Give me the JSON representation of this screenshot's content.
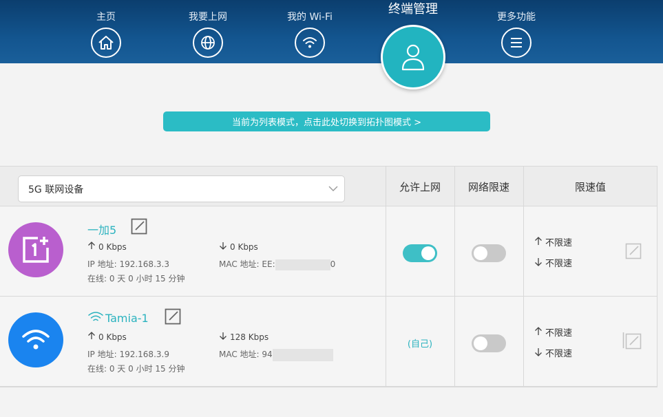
{
  "nav": {
    "items": [
      {
        "label": "主页",
        "icon": "home-icon"
      },
      {
        "label": "我要上网",
        "icon": "globe-icon"
      },
      {
        "label": "我的 Wi-Fi",
        "icon": "wifi-icon"
      },
      {
        "label": "终端管理",
        "icon": "user-icon",
        "active": true
      },
      {
        "label": "更多功能",
        "icon": "menu-icon"
      }
    ]
  },
  "mode_switch": "当前为列表模式，点击此处切换到拓扑图模式 >",
  "table": {
    "filter_value": "5G 联网设备",
    "headers": {
      "allow": "允许上网",
      "limit": "网络限速",
      "limit_value": "限速值"
    }
  },
  "devices": [
    {
      "name": "一加5",
      "up": "0 Kbps",
      "down": "0 Kbps",
      "ip": "IP 地址: 192.168.3.3",
      "mac_prefix": "MAC 地址: EE:",
      "mac_suffix": "0",
      "online": "在线: 0 天 0 小时 15 分钟",
      "allow_on": true,
      "limit_on": false,
      "limit_up": "不限速",
      "limit_down": "不限速",
      "avatar_color": "#b95fce",
      "icon": "oneplus-logo-icon"
    },
    {
      "name": "Tamia-1",
      "up": "0 Kbps",
      "down": "128 Kbps",
      "ip": "IP 地址: 192.168.3.9",
      "mac_prefix": "MAC 地址: 94",
      "mac_suffix": "",
      "online": "在线: 0 天 0 小时 15 分钟",
      "self_label": "(自己)",
      "limit_on": false,
      "limit_up": "不限速",
      "limit_down": "不限速",
      "avatar_color": "#1a84ef",
      "icon": "wifi-icon"
    }
  ],
  "colors": {
    "accent": "#2bbcc5",
    "header": "#13558f"
  }
}
